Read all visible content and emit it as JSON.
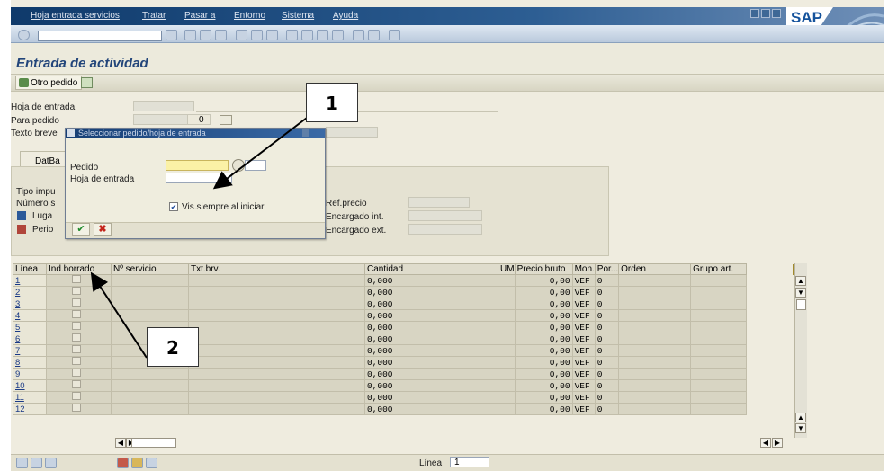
{
  "menubar": {
    "items": [
      "Hoja entrada servicios",
      "Tratar",
      "Pasar a",
      "Entorno",
      "Sistema",
      "Ayuda"
    ],
    "brand": "SAP"
  },
  "screen": {
    "title": "Entrada de actividad"
  },
  "app_toolbar": {
    "otro_pedido": "Otro pedido"
  },
  "header": {
    "hoja_entrada_label": "Hoja de entrada",
    "para_pedido_label": "Para pedido",
    "para_pedido_pos": "0",
    "texto_breve_label": "Texto breve"
  },
  "tab": {
    "label": "DatBa"
  },
  "detail": {
    "tipo_imp_label": "Tipo impu",
    "numero_label": "Número s",
    "lugar_label": "Luga",
    "periodo_label": "Perio",
    "ref_precio_label": "Ref.precio",
    "encargado_int_label": "Encargado int.",
    "encargado_ext_label": "Encargado ext."
  },
  "popup": {
    "title": "Seleccionar pedido/hoja de entrada",
    "pedido_label": "Pedido",
    "hoja_entrada_label": "Hoja de entrada",
    "checkbox_label": "Vis.siempre al iniciar",
    "checkbox_checked": true
  },
  "table": {
    "columns": [
      "Línea",
      "Ind.borrado",
      "Nº servicio",
      "Txt.brv.",
      "Cantidad",
      "UM",
      "Precio bruto",
      "Mon.",
      "Por...",
      "Orden",
      "Grupo art."
    ],
    "rows": [
      {
        "linea": "1",
        "cantidad": "0,000",
        "precio": "0,00",
        "mon": "VEF",
        "por": "0"
      },
      {
        "linea": "2",
        "cantidad": "0,000",
        "precio": "0,00",
        "mon": "VEF",
        "por": "0"
      },
      {
        "linea": "3",
        "cantidad": "0,000",
        "precio": "0,00",
        "mon": "VEF",
        "por": "0"
      },
      {
        "linea": "4",
        "cantidad": "0,000",
        "precio": "0,00",
        "mon": "VEF",
        "por": "0"
      },
      {
        "linea": "5",
        "cantidad": "0,000",
        "precio": "0,00",
        "mon": "VEF",
        "por": "0"
      },
      {
        "linea": "6",
        "cantidad": "0,000",
        "precio": "0,00",
        "mon": "VEF",
        "por": "0"
      },
      {
        "linea": "7",
        "cantidad": "0,000",
        "precio": "0,00",
        "mon": "VEF",
        "por": "0"
      },
      {
        "linea": "8",
        "cantidad": "0,000",
        "precio": "0,00",
        "mon": "VEF",
        "por": "0"
      },
      {
        "linea": "9",
        "cantidad": "0,000",
        "precio": "0,00",
        "mon": "VEF",
        "por": "0"
      },
      {
        "linea": "10",
        "cantidad": "0,000",
        "precio": "0,00",
        "mon": "VEF",
        "por": "0"
      },
      {
        "linea": "11",
        "cantidad": "0,000",
        "precio": "0,00",
        "mon": "VEF",
        "por": "0"
      },
      {
        "linea": "12",
        "cantidad": "0,000",
        "precio": "0,00",
        "mon": "VEF",
        "por": "0"
      }
    ]
  },
  "footer": {
    "linea_label": "Línea",
    "linea_value": "1"
  },
  "annotations": {
    "callout1": "1",
    "callout2": "2"
  },
  "colors": {
    "menubar": "#0f3a6b",
    "title": "#22457a",
    "field_required": "#fbf1a6",
    "arrow": "#000000"
  }
}
